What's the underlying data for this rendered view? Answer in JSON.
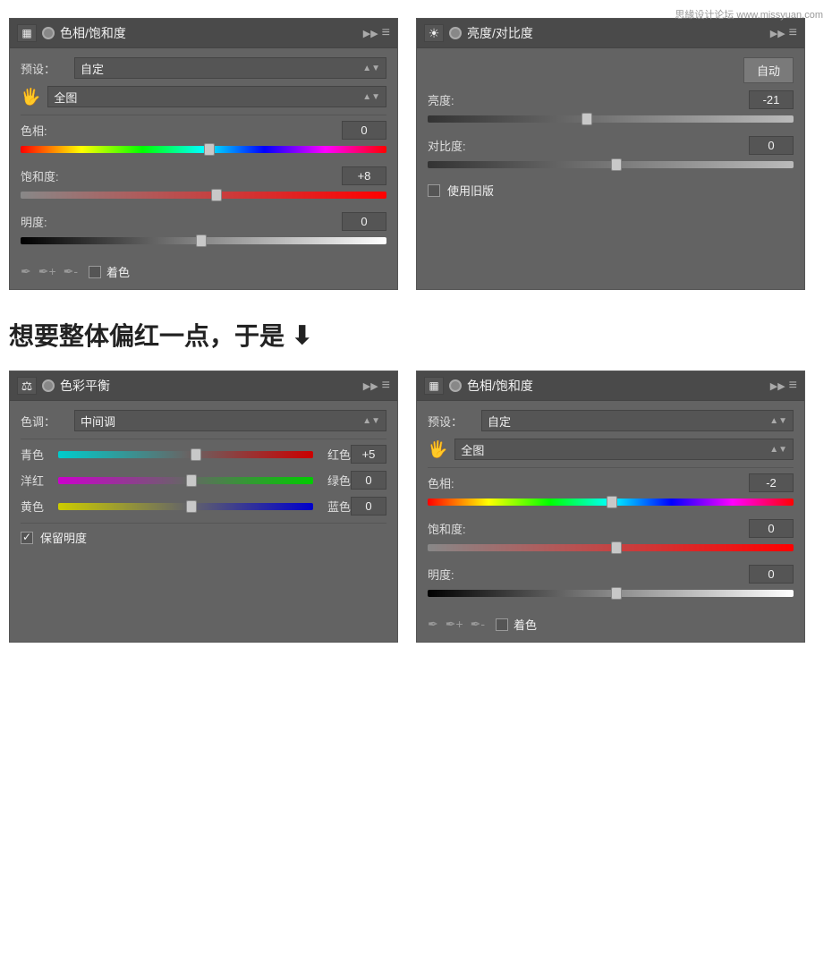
{
  "watermark": "思緣设计论坛 www.missyuan.com",
  "panel1": {
    "title": "色相/饱和度",
    "preset_label": "预设：",
    "preset_value": "自定",
    "channel_value": "全图",
    "hue_label": "色相:",
    "hue_value": "0",
    "saturation_label": "饱和度:",
    "saturation_value": "+8",
    "lightness_label": "明度:",
    "lightness_value": "0",
    "colorize_label": "着色",
    "hue_thumb_pct": "50",
    "sat_thumb_pct": "52",
    "light_thumb_pct": "48"
  },
  "panel2": {
    "title": "亮度/对比度",
    "auto_label": "自动",
    "brightness_label": "亮度:",
    "brightness_value": "-21",
    "contrast_label": "对比度:",
    "contrast_value": "0",
    "legacy_label": "使用旧版",
    "brightness_thumb_pct": "48",
    "contrast_thumb_pct": "50"
  },
  "middle_text": "想要整体偏红一点，于是",
  "panel3": {
    "title": "色彩平衡",
    "tone_label": "色调：",
    "tone_value": "中间调",
    "cyan_label": "青色",
    "red_label": "红色",
    "cyan_red_value": "+5",
    "magenta_label": "洋红",
    "green_label": "绿色",
    "magenta_green_value": "0",
    "yellow_label": "黄色",
    "blue_label": "蓝色",
    "yellow_blue_value": "0",
    "preserve_label": "保留明度",
    "cyan_red_thumb_pct": "52",
    "magenta_green_thumb_pct": "50",
    "yellow_blue_thumb_pct": "50"
  },
  "panel4": {
    "title": "色相/饱和度",
    "preset_label": "预设：",
    "preset_value": "自定",
    "channel_value": "全图",
    "hue_label": "色相:",
    "hue_value": "-2",
    "saturation_label": "饱和度:",
    "saturation_value": "0",
    "lightness_label": "明度:",
    "lightness_value": "0",
    "colorize_label": "着色",
    "hue_thumb_pct": "49",
    "sat_thumb_pct": "50",
    "light_thumb_pct": "50"
  }
}
